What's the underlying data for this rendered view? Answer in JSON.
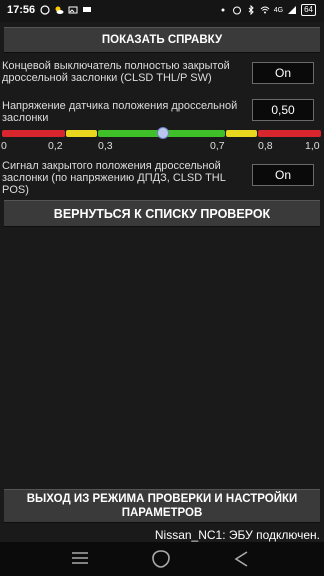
{
  "status_bar": {
    "time": "17:56",
    "network": "4G",
    "battery": "64",
    "icons": [
      "whatsapp-icon",
      "weather-icon",
      "gallery-icon",
      "message-icon",
      "dot-icon",
      "alarm-icon",
      "bluetooth-icon",
      "wifi-icon",
      "signal-icon",
      "battery-icon"
    ]
  },
  "help_button": "ПОКАЗАТЬ СПРАВКУ",
  "params": [
    {
      "label": "Концевой выключатель полностью закрытой дроссельной заслонки (CLSD THL/P SW)",
      "value": "On"
    },
    {
      "label": "Напряжение датчика положения дроссельной заслонки",
      "value": "0,50"
    },
    {
      "label": "Сигнал закрытого положения дроссельной заслонки (по напряжению ДПДЗ, CLSD THL POS)",
      "value": "On"
    }
  ],
  "gauge": {
    "ticks": [
      "0",
      "0,2",
      "0,3",
      "0,7",
      "0,8",
      "1,0"
    ],
    "value": 0.5,
    "min": 0,
    "max": 1.0,
    "zones": [
      {
        "from": 0,
        "to": 0.2,
        "color": "#d9262e"
      },
      {
        "from": 0.2,
        "to": 0.3,
        "color": "#e8d61f"
      },
      {
        "from": 0.3,
        "to": 0.7,
        "color": "#3fbf28"
      },
      {
        "from": 0.7,
        "to": 0.8,
        "color": "#e8d61f"
      },
      {
        "from": 0.8,
        "to": 1.0,
        "color": "#d9262e"
      }
    ]
  },
  "back_button": "ВЕРНУТЬСЯ К СПИСКУ ПРОВЕРОК",
  "exit_button": "ВЫХОД ИЗ РЕЖИМА ПРОВЕРКИ И НАСТРОЙКИ ПАРАМЕТРОВ",
  "connection_status": "Nissan_NC1: ЭБУ подключен.",
  "nav": {
    "menu_icon": "menu-icon",
    "home_icon": "home-icon",
    "back_icon": "back-icon"
  }
}
